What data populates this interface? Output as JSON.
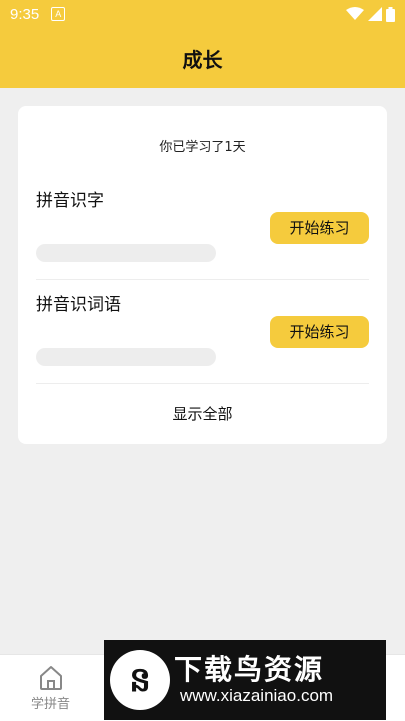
{
  "status": {
    "time": "9:35",
    "notification_badge": "A"
  },
  "header": {
    "title": "成长"
  },
  "card": {
    "learned_days_text": "你已学习了1天",
    "items": [
      {
        "title": "拼音识字",
        "button_label": "开始练习",
        "progress": 0
      },
      {
        "title": "拼音识词语",
        "button_label": "开始练习",
        "progress": 0
      }
    ],
    "show_all_label": "显示全部"
  },
  "tabbar": {
    "tabs": [
      {
        "label": "学拼音",
        "icon": "home-icon"
      }
    ]
  },
  "watermark": {
    "logo_char": "ន",
    "title": "下载鸟资源",
    "url": "www.xiazainiao.com"
  },
  "colors": {
    "accent": "#f5cb3d",
    "background": "#efefef",
    "progress_track": "#ededed"
  }
}
